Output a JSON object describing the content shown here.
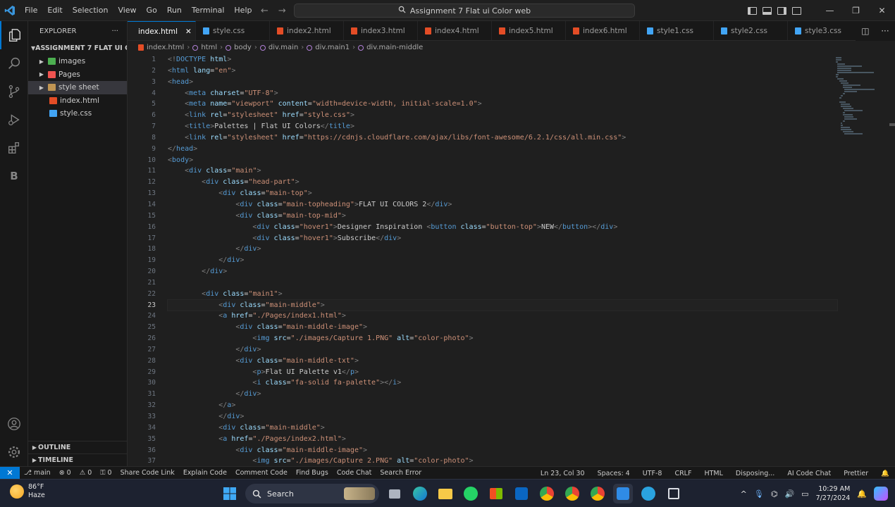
{
  "titlebar": {
    "menu": [
      "File",
      "Edit",
      "Selection",
      "View",
      "Go",
      "Run",
      "Terminal",
      "Help"
    ],
    "command_center": "Assignment 7 Flat ui Color web"
  },
  "sidebar": {
    "title": "EXPLORER",
    "project": "ASSIGNMENT 7 FLAT UI C...",
    "items": [
      {
        "label": "images",
        "type": "folder-images"
      },
      {
        "label": "Pages",
        "type": "folder-pages"
      },
      {
        "label": "style sheet",
        "type": "folder"
      },
      {
        "label": "index.html",
        "type": "html"
      },
      {
        "label": "style.css",
        "type": "css"
      }
    ],
    "outline": "OUTLINE",
    "timeline": "TIMELINE"
  },
  "tabs": [
    {
      "label": "index.html",
      "type": "html",
      "active": true
    },
    {
      "label": "style.css",
      "type": "css"
    },
    {
      "label": "index2.html",
      "type": "html"
    },
    {
      "label": "index3.html",
      "type": "html"
    },
    {
      "label": "index4.html",
      "type": "html"
    },
    {
      "label": "index5.html",
      "type": "html"
    },
    {
      "label": "index6.html",
      "type": "html"
    },
    {
      "label": "style1.css",
      "type": "css"
    },
    {
      "label": "style2.css",
      "type": "css"
    },
    {
      "label": "style3.css",
      "type": "css"
    }
  ],
  "breadcrumb": [
    "index.html",
    "html",
    "body",
    "div.main",
    "div.main1",
    "div.main-middle"
  ],
  "editor": {
    "current_line": 23,
    "lines": [
      "<!DOCTYPE html>",
      "<html lang=\"en\">",
      "<head>",
      "    <meta charset=\"UTF-8\">",
      "    <meta name=\"viewport\" content=\"width=device-width, initial-scale=1.0\">",
      "    <link rel=\"stylesheet\" href=\"style.css\">",
      "    <title>Palettes | Flat UI Colors</title>",
      "    <link rel=\"stylesheet\" href=\"https://cdnjs.cloudflare.com/ajax/libs/font-awesome/6.2.1/css/all.min.css\">",
      "</head>",
      "<body>",
      "    <div class=\"main\">",
      "        <div class=\"head-part\">",
      "            <div class=\"main-top\">",
      "                <div class=\"main-topheading\">FLAT UI COLORS 2</div>",
      "                <div class=\"main-top-mid\">",
      "                    <div class=\"hover1\">Designer Inspiration <button class=\"button-top\">NEW</button></div>",
      "                    <div class=\"hover1\">Subscribe</div>",
      "                </div>",
      "            </div>",
      "        </div>",
      "",
      "        <div class=\"main1\">",
      "            <div class=\"main-middle\">",
      "            <a href=\"./Pages/index1.html\">",
      "                <div class=\"main-middle-image\">",
      "                    <img src=\"./images/Capture 1.PNG\" alt=\"color-photo\">",
      "                </div>",
      "                <div class=\"main-middle-txt\">",
      "                    <p>Flat UI Palette v1</p>",
      "                    <i class=\"fa-solid fa-palette\"></i>",
      "                </div>",
      "            </a>",
      "            </div>",
      "            <div class=\"main-middle\">",
      "            <a href=\"./Pages/index2.html\">",
      "                <div class=\"main-middle-image\">",
      "                    <img src=\"./images/Capture 2.PNG\" alt=\"color-photo\">"
    ]
  },
  "statusbar": {
    "left": [
      "main",
      "0",
      "0",
      "0",
      "Share Code Link",
      "Explain Code",
      "Comment Code",
      "Find Bugs",
      "Code Chat",
      "Search Error"
    ],
    "right": [
      "Ln 23, Col 30",
      "Spaces: 4",
      "UTF-8",
      "CRLF",
      "HTML",
      "Disposing...",
      "AI Code Chat",
      "Prettier"
    ]
  },
  "taskbar": {
    "temp": "86°F",
    "weather": "Haze",
    "search": "Search",
    "time": "10:29 AM",
    "date": "7/27/2024"
  },
  "colors": {
    "accent": "#0078d4",
    "tag": "#569cd6",
    "attr": "#9cdcfe",
    "string": "#ce9178",
    "bracket": "#808080"
  }
}
